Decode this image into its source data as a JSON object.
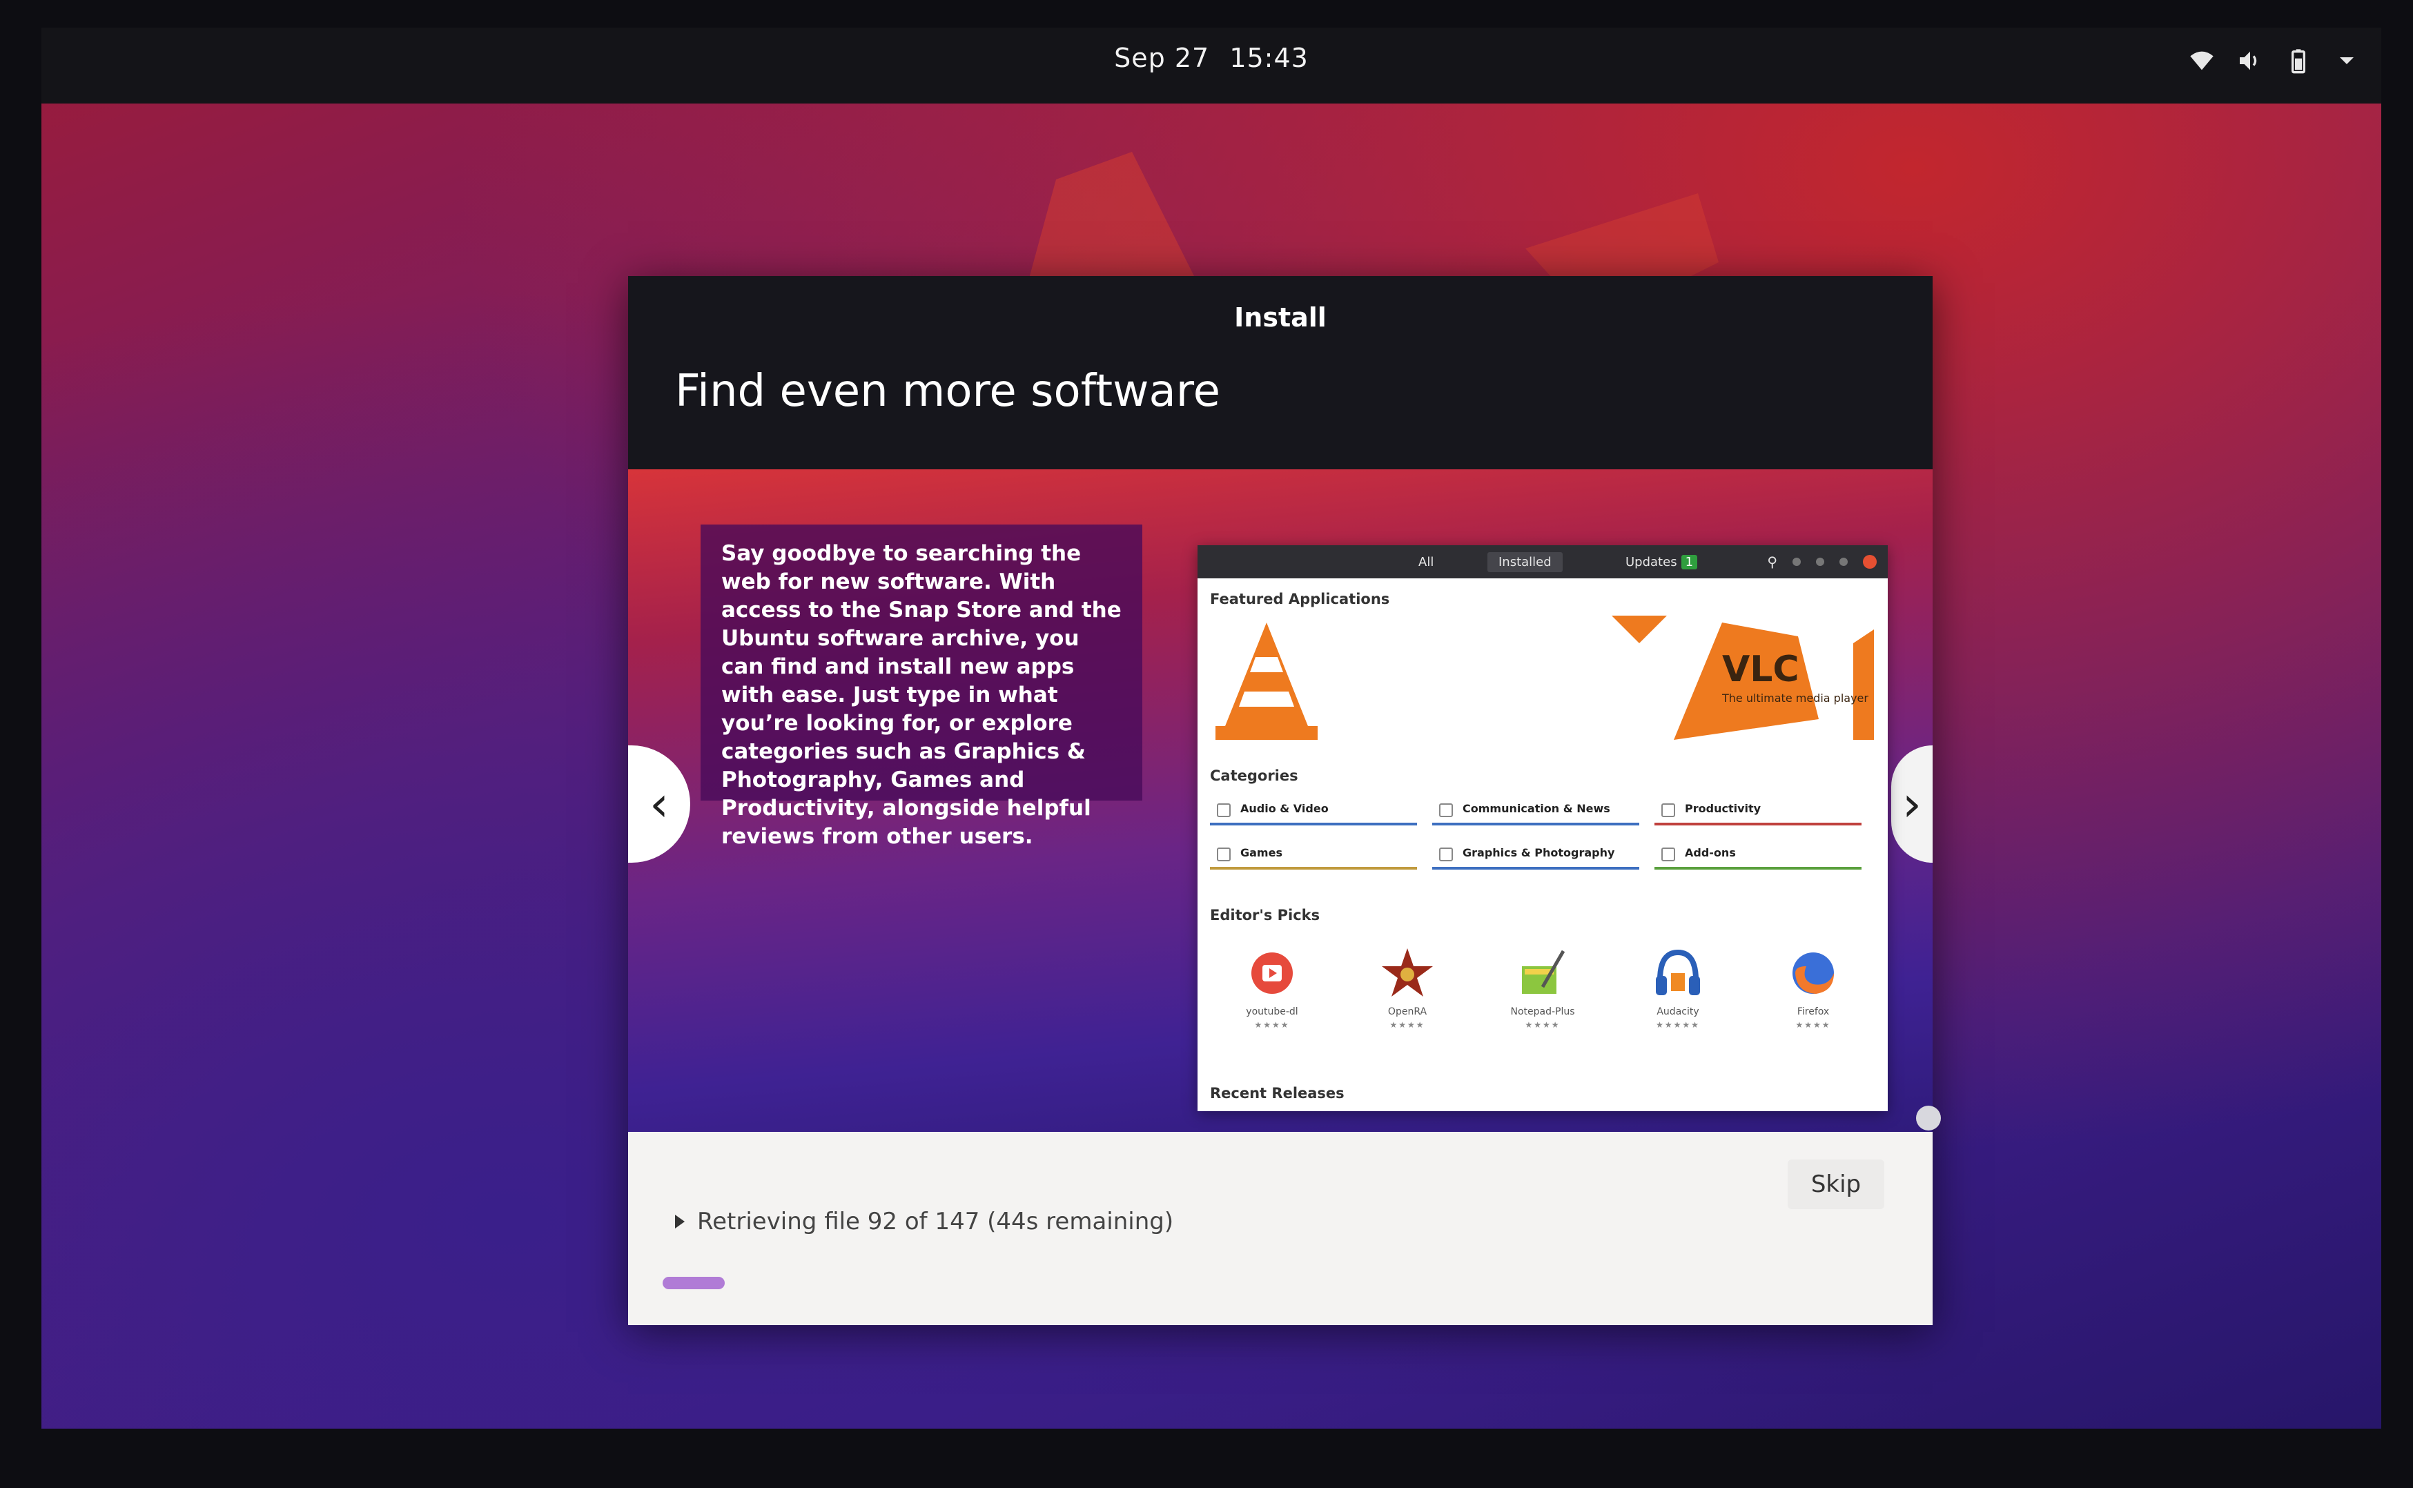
{
  "topbar": {
    "date": "Sep 27",
    "time": "15:43",
    "tray_icons": [
      "network-icon",
      "volume-icon",
      "battery-icon",
      "system-menu-chevron-icon"
    ]
  },
  "installer": {
    "window_title": "Install",
    "page_title": "Find even more software",
    "description": "Say goodbye to searching the web for new software. With access to the Snap Store and the Ubuntu software archive, you can find and install new apps with ease. Just type in what you’re looking for, or explore categories such as Graphics & Photography, Games and Productivity, alongside helpful reviews from other users.",
    "prev_label": "‹",
    "next_label": "›",
    "skip_label": "Skip",
    "status_text": "Retrieving file 92 of 147 (44s remaining)",
    "progress_fraction": 0.09
  },
  "software_center": {
    "tabs": {
      "all": "All",
      "installed": "Installed",
      "updates": "Updates",
      "updates_count": "1"
    },
    "featured_label": "Featured Applications",
    "featured_app": {
      "name": "VLC",
      "tagline": "The ultimate media player"
    },
    "categories_label": "Categories",
    "categories": [
      "Audio & Video",
      "Communication & News",
      "Productivity",
      "Games",
      "Graphics & Photography",
      "Add-ons"
    ],
    "category_colors": [
      "#3d6fc0",
      "#3d6fc0",
      "#c0413d",
      "#c09a3d",
      "#3d6fc0",
      "#5aa03d"
    ],
    "editors_picks_label": "Editor's Picks",
    "picks": [
      {
        "name": "youtube-dl",
        "stars": "★★★★"
      },
      {
        "name": "OpenRA",
        "stars": "★★★★"
      },
      {
        "name": "Notepad-Plus",
        "stars": "★★★★"
      },
      {
        "name": "Audacity",
        "stars": "★★★★★"
      },
      {
        "name": "Firefox",
        "stars": "★★★★"
      }
    ],
    "recent_label": "Recent Releases"
  }
}
